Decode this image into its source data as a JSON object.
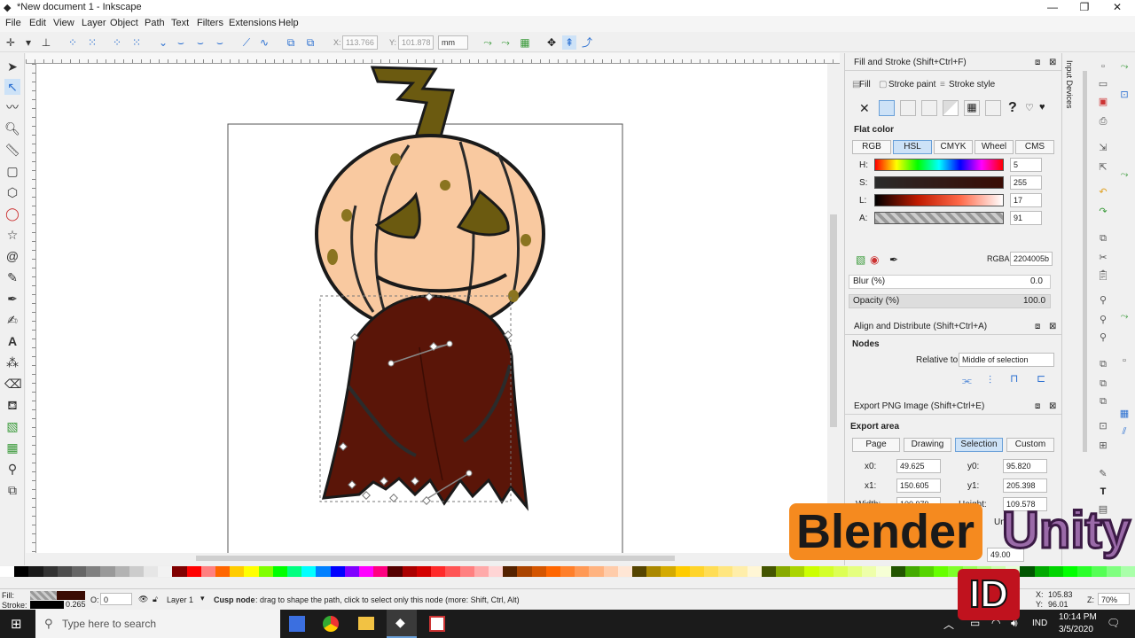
{
  "window": {
    "title": "*New document 1 - Inkscape",
    "minimize_icon": "minimize-icon",
    "maximize_icon": "maximize-icon",
    "close_icon": "close-icon"
  },
  "menu": [
    "File",
    "Edit",
    "View",
    "Layer",
    "Object",
    "Path",
    "Text",
    "Filters",
    "Extensions",
    "Help"
  ],
  "tool_controls": {
    "x_label": "X:",
    "x_value": "113.766",
    "y_label": "Y:",
    "y_value": "101.878",
    "unit": "mm"
  },
  "fill_stroke": {
    "title": "Fill and Stroke (Shift+Ctrl+F)",
    "tabs": [
      "Fill",
      "Stroke paint",
      "Stroke style"
    ],
    "paint_mode": "Flat color",
    "color_tabs": [
      "RGB",
      "HSL",
      "CMYK",
      "Wheel",
      "CMS"
    ],
    "active_color_tab": "HSL",
    "h_label": "H:",
    "h_value": "5",
    "s_label": "S:",
    "s_value": "255",
    "l_label": "L:",
    "l_value": "17",
    "a_label": "A:",
    "a_value": "91",
    "rgba_label": "RGBA:",
    "rgba_value": "2204005b",
    "blur_label": "Blur (%)",
    "blur_value": "0.0",
    "opacity_label": "Opacity (%)",
    "opacity_value": "100.0"
  },
  "align": {
    "title": "Align and Distribute (Shift+Ctrl+A)",
    "section": "Nodes",
    "relative_label": "Relative to:",
    "relative_value": "Middle of selection"
  },
  "export": {
    "title": "Export PNG Image (Shift+Ctrl+E)",
    "section": "Export area",
    "tabs": [
      "Page",
      "Drawing",
      "Selection",
      "Custom"
    ],
    "active_tab": "Selection",
    "x0_label": "x0:",
    "x0_value": "49.625",
    "y0_label": "y0:",
    "y0_value": "95.820",
    "x1_label": "x1:",
    "x1_value": "150.605",
    "y1_label": "y1:",
    "y1_value": "205.398",
    "width_label": "Width:",
    "width_value": "100.979",
    "height_label": "Height:",
    "height_value": "109.578",
    "dpi_value": "49.00",
    "units_partial": "Un"
  },
  "dock_side_label": "Input Devices",
  "status": {
    "fill_label": "Fill:",
    "stroke_label": "Stroke:",
    "stroke_width": "0.265",
    "opacity_label": "O:",
    "opacity_value": "0",
    "layer": "Layer 1",
    "message_bold": "Cusp node",
    "message_rest": ": drag to shape the path, click to select only this node (more: Shift, Ctrl, Alt)",
    "x_label": "X:",
    "x_value": "105.83",
    "y_label": "Y:",
    "y_value": "96.01",
    "zoom_label": "Z:",
    "zoom_value": "70%"
  },
  "taskbar": {
    "search_placeholder": "Type here to search",
    "lang": "IND",
    "time": "10:14 PM",
    "date": "3/5/2020"
  },
  "watermarks": {
    "blender": "Blender",
    "unity": "Unity",
    "id": "ID"
  },
  "colors": {
    "pumpkin": "#f9c9a0",
    "cloak": "#5a1508",
    "stem": "#6b5a10",
    "accent_blue": "#2a6fd1",
    "blender_orange": "#f58a1f",
    "unity_purple": "#5b2a6b",
    "id_red": "#c0121e"
  }
}
